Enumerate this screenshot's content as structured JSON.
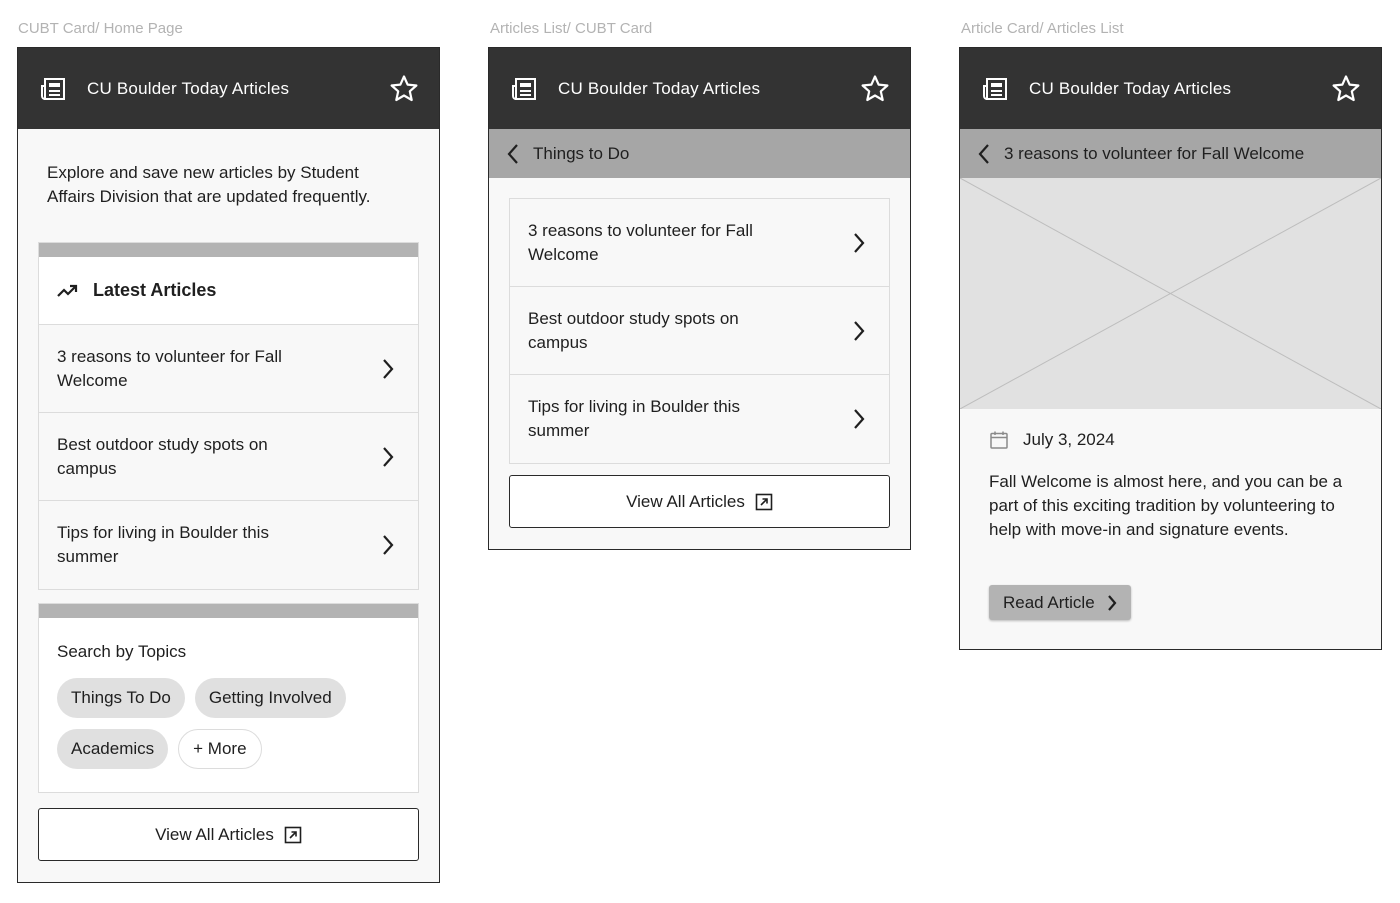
{
  "frames": {
    "home": {
      "label": "CUBT Card/ Home Page",
      "header_title": "CU Boulder Today Articles",
      "intro": "Explore and save new articles by Student Affairs Division that are updated frequently.",
      "latest_title": "Latest Articles",
      "latest_items": [
        {
          "title": "3 reasons to volunteer for Fall Welcome"
        },
        {
          "title": "Best outdoor study spots on campus"
        },
        {
          "title": "Tips for living in Boulder this summer"
        }
      ],
      "topics_title": "Search by Topics",
      "topics": [
        "Things To Do",
        "Getting Involved",
        "Academics"
      ],
      "more_label": "+ More",
      "view_all_label": "View All Articles"
    },
    "list": {
      "label": "Articles List/ CUBT Card",
      "header_title": "CU Boulder Today Articles",
      "back_title": "Things to Do",
      "items": [
        {
          "title": "3 reasons to volunteer for Fall Welcome"
        },
        {
          "title": "Best outdoor study spots on campus"
        },
        {
          "title": "Tips for living in Boulder this summer"
        }
      ],
      "view_all_label": "View All Articles"
    },
    "article": {
      "label": "Article Card/ Articles List",
      "header_title": "CU Boulder Today Articles",
      "back_title": "3 reasons to volunteer for Fall Welcome",
      "date": "July 3, 2024",
      "description": "Fall Welcome is almost here, and you can be a part of this exciting tradition by volunteering to help with move-in and signature events.",
      "read_label": "Read Article"
    }
  },
  "icons": {
    "header_left": "newspaper-icon",
    "header_right": "star-icon",
    "trending": "trending-up-icon",
    "row_chevron": "chevron-right-icon",
    "back": "chevron-left-icon",
    "external": "external-link-icon",
    "calendar": "calendar-icon"
  },
  "colors": {
    "header_bg": "#333333",
    "subheader_bg": "#a6a6a6",
    "section_bar": "#b3b3b3",
    "chip_bg": "#e0e0e0",
    "placeholder_bg": "#e1e1e1"
  }
}
